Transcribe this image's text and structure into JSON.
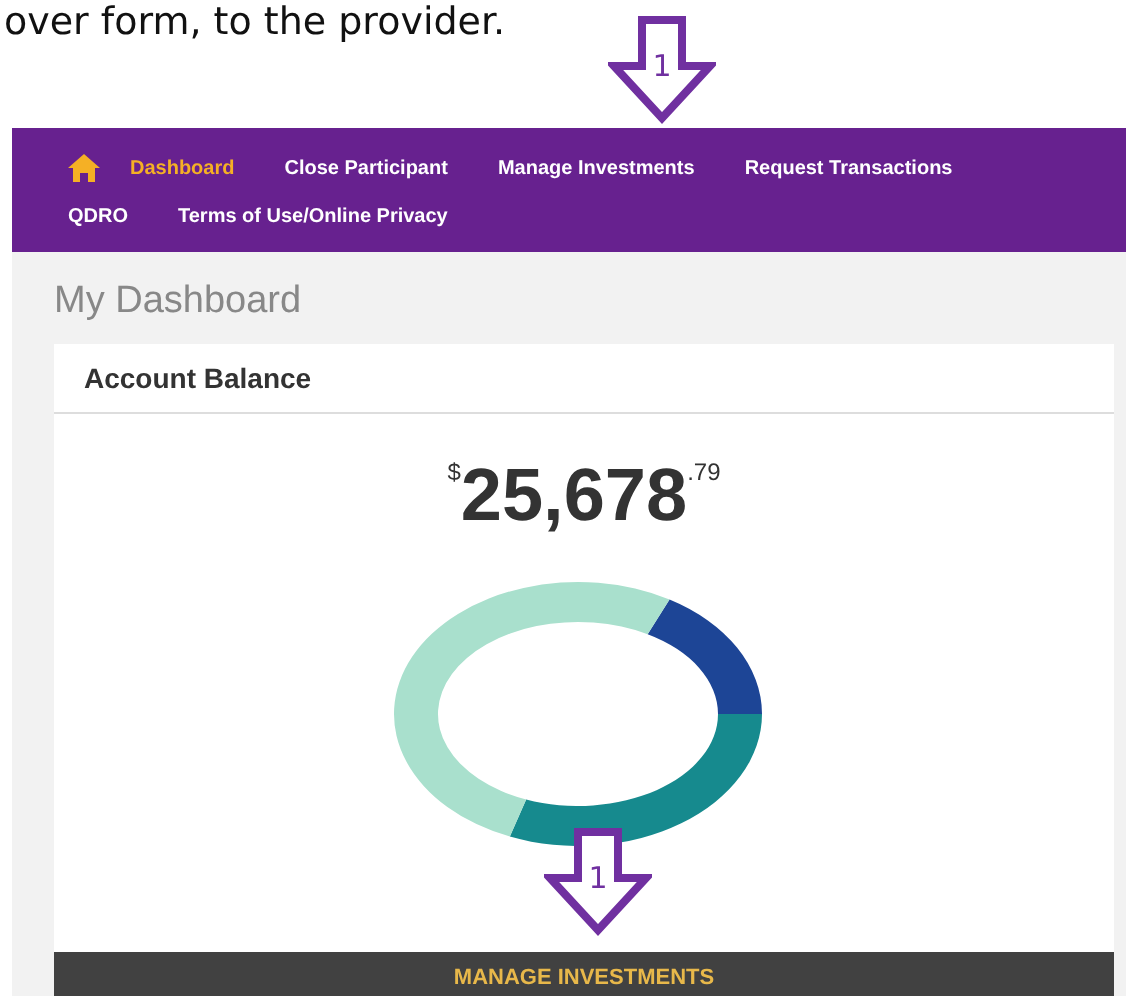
{
  "document_text": "over form, to the provider.",
  "nav": {
    "rows": [
      [
        {
          "kind": "home",
          "label": "Dashboard",
          "selected": true
        },
        {
          "kind": "link",
          "label": "Close Participant",
          "selected": false
        },
        {
          "kind": "link",
          "label": "Manage Investments",
          "selected": false
        },
        {
          "kind": "link",
          "label": "Request Transactions",
          "selected": false
        }
      ],
      [
        {
          "kind": "link",
          "label": "QDRO",
          "selected": false
        },
        {
          "kind": "link",
          "label": "Terms of Use/Online Privacy",
          "selected": false
        }
      ]
    ]
  },
  "page_title": "My Dashboard",
  "card": {
    "title": "Account Balance",
    "balance": {
      "currency": "$",
      "whole": "25,678",
      "cents": ".79"
    },
    "button": "MANAGE INVESTMENTS"
  },
  "annotations": [
    {
      "label": "1"
    },
    {
      "label": "1"
    }
  ]
}
